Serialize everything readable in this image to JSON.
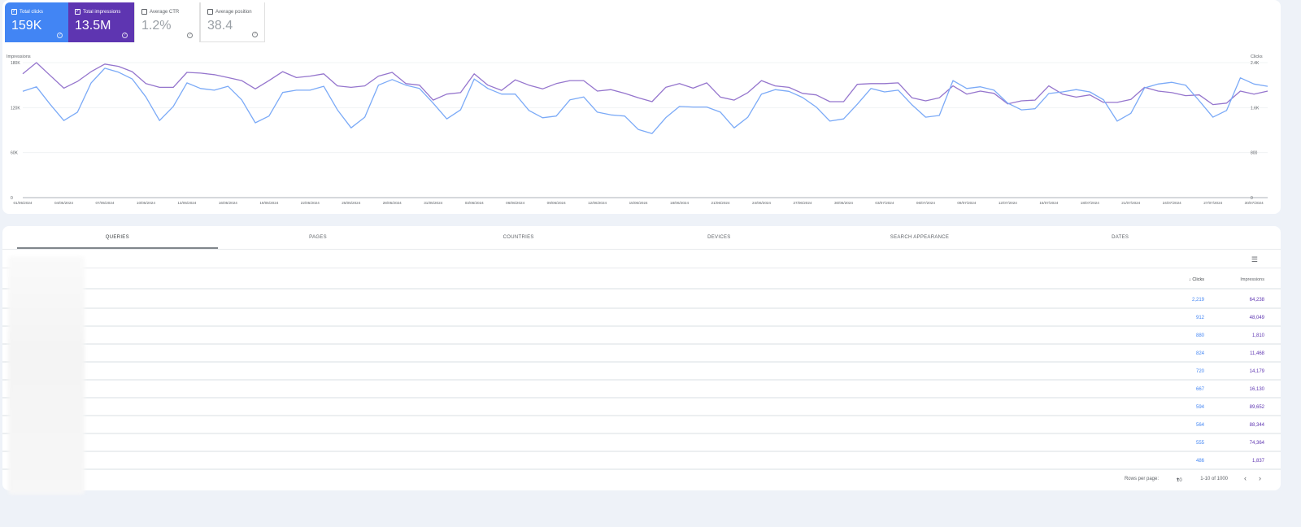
{
  "metrics": [
    {
      "label": "Total clicks",
      "value": "159K",
      "checked": true,
      "color": "#4285f4"
    },
    {
      "label": "Total impressions",
      "value": "13.5M",
      "checked": true,
      "color": "#5e35b1"
    },
    {
      "label": "Average CTR",
      "value": "1.2%",
      "checked": false
    },
    {
      "label": "Average position",
      "value": "38.4",
      "checked": false
    }
  ],
  "chart_data": {
    "type": "line",
    "left_axis_label": "Impressions",
    "right_axis_label": "Clicks",
    "left_ylim": [
      0,
      180000
    ],
    "right_ylim": [
      0,
      2400
    ],
    "left_ticks": [
      "0",
      "60K",
      "120K",
      "180K"
    ],
    "right_ticks": [
      "0",
      "800",
      "1.6K",
      "2.4K"
    ],
    "grid": true,
    "x": [
      "01/05/2024",
      "02/05/2024",
      "03/05/2024",
      "04/05/2024",
      "05/05/2024",
      "06/05/2024",
      "07/05/2024",
      "08/05/2024",
      "09/05/2024",
      "10/05/2024",
      "11/05/2024",
      "12/05/2024",
      "13/05/2024",
      "14/05/2024",
      "15/05/2024",
      "16/05/2024",
      "17/05/2024",
      "18/05/2024",
      "19/05/2024",
      "20/05/2024",
      "21/05/2024",
      "22/05/2024",
      "23/05/2024",
      "24/05/2024",
      "25/05/2024",
      "26/05/2024",
      "27/05/2024",
      "28/05/2024",
      "29/05/2024",
      "30/05/2024",
      "31/05/2024",
      "01/06/2024",
      "02/06/2024",
      "03/06/2024",
      "04/06/2024",
      "05/06/2024",
      "06/06/2024",
      "07/06/2024",
      "08/06/2024",
      "09/06/2024",
      "10/06/2024",
      "11/06/2024",
      "12/06/2024",
      "13/06/2024",
      "14/06/2024",
      "15/06/2024",
      "16/06/2024",
      "17/06/2024",
      "18/06/2024",
      "19/06/2024",
      "20/06/2024",
      "21/06/2024",
      "22/06/2024",
      "23/06/2024",
      "24/06/2024",
      "25/06/2024",
      "26/06/2024",
      "27/06/2024",
      "28/06/2024",
      "29/06/2024",
      "30/06/2024",
      "01/07/2024",
      "02/07/2024",
      "03/07/2024",
      "04/07/2024",
      "05/07/2024",
      "06/07/2024",
      "07/07/2024",
      "08/07/2024",
      "09/07/2024",
      "10/07/2024",
      "11/07/2024",
      "12/07/2024",
      "13/07/2024",
      "14/07/2024",
      "15/07/2024",
      "16/07/2024",
      "17/07/2024",
      "18/07/2024",
      "19/07/2024",
      "20/07/2024",
      "21/07/2024",
      "22/07/2024",
      "23/07/2024",
      "24/07/2024",
      "25/07/2024",
      "26/07/2024",
      "27/07/2024",
      "28/07/2024",
      "29/07/2024",
      "30/07/2024",
      "31/07/2024"
    ],
    "x_tick_labels": [
      "01/05/2024",
      "04/05/2024",
      "07/05/2024",
      "10/05/2024",
      "13/05/2024",
      "16/05/2024",
      "19/05/2024",
      "22/05/2024",
      "25/05/2024",
      "28/05/2024",
      "31/05/2024",
      "03/06/2024",
      "06/06/2024",
      "09/06/2024",
      "12/06/2024",
      "15/06/2024",
      "18/06/2024",
      "21/06/2024",
      "24/06/2024",
      "27/06/2024",
      "30/06/2024",
      "03/07/2024",
      "06/07/2024",
      "09/07/2024",
      "12/07/2024",
      "15/07/2024",
      "18/07/2024",
      "21/07/2024",
      "24/07/2024",
      "27/07/2024",
      "30/07/2024"
    ],
    "series": [
      {
        "name": "Impressions",
        "axis": "left",
        "color": "#9575cd",
        "values": [
          165000,
          180000,
          163000,
          146000,
          155000,
          168000,
          178000,
          175000,
          168000,
          152000,
          147000,
          147000,
          167000,
          166000,
          164000,
          160000,
          156000,
          145000,
          156000,
          168000,
          160000,
          162000,
          165000,
          149000,
          147000,
          149000,
          162000,
          167000,
          152000,
          150000,
          130000,
          138000,
          140000,
          165000,
          150000,
          143000,
          157000,
          150000,
          145000,
          152000,
          156000,
          156000,
          142000,
          144000,
          139000,
          133000,
          128000,
          147000,
          152000,
          146000,
          153000,
          134000,
          130000,
          140000,
          156000,
          149000,
          147000,
          139000,
          137000,
          128000,
          128000,
          151000,
          152000,
          152000,
          153000,
          133000,
          129000,
          133000,
          149000,
          138000,
          142000,
          139000,
          125000,
          129000,
          130000,
          149000,
          138000,
          134000,
          137000,
          127000,
          127000,
          131000,
          147000,
          142000,
          140000,
          136000,
          137000,
          124000,
          126000,
          142000,
          138000,
          142000
        ]
      },
      {
        "name": "Clicks",
        "axis": "right",
        "color": "#7baaf7",
        "values": [
          1890,
          1970,
          1660,
          1370,
          1520,
          2040,
          2300,
          2230,
          2110,
          1790,
          1370,
          1620,
          2040,
          1940,
          1910,
          1980,
          1740,
          1330,
          1450,
          1870,
          1910,
          1910,
          1980,
          1560,
          1240,
          1430,
          2000,
          2100,
          2000,
          1940,
          1680,
          1400,
          1560,
          2110,
          1940,
          1840,
          1840,
          1550,
          1420,
          1450,
          1740,
          1790,
          1520,
          1470,
          1450,
          1210,
          1140,
          1420,
          1620,
          1610,
          1610,
          1520,
          1240,
          1430,
          1840,
          1920,
          1890,
          1780,
          1610,
          1360,
          1400,
          1660,
          1940,
          1880,
          1910,
          1650,
          1430,
          1460,
          2080,
          1940,
          1970,
          1910,
          1680,
          1560,
          1580,
          1850,
          1880,
          1920,
          1880,
          1740,
          1360,
          1500,
          1950,
          2020,
          2050,
          2000,
          1720,
          1430,
          1550,
          2130,
          2020,
          1980
        ]
      }
    ]
  },
  "tabs": [
    "QUERIES",
    "PAGES",
    "COUNTRIES",
    "DEVICES",
    "SEARCH APPEARANCE",
    "DATES"
  ],
  "table": {
    "columns": {
      "clicks": "Clicks",
      "impressions": "Impressions"
    },
    "rows": [
      {
        "clicks": "2,219",
        "impressions": "64,238"
      },
      {
        "clicks": "912",
        "impressions": "48,049"
      },
      {
        "clicks": "880",
        "impressions": "1,810"
      },
      {
        "clicks": "824",
        "impressions": "11,468"
      },
      {
        "clicks": "720",
        "impressions": "14,179"
      },
      {
        "clicks": "667",
        "impressions": "16,130"
      },
      {
        "clicks": "594",
        "impressions": "89,652"
      },
      {
        "clicks": "564",
        "impressions": "88,344"
      },
      {
        "clicks": "555",
        "impressions": "74,364"
      },
      {
        "clicks": "486",
        "impressions": "1,837"
      }
    ]
  },
  "pagination": {
    "rows_per_page_label": "Rows per page:",
    "rows_per_page": "10",
    "range": "1-10 of 1000"
  }
}
